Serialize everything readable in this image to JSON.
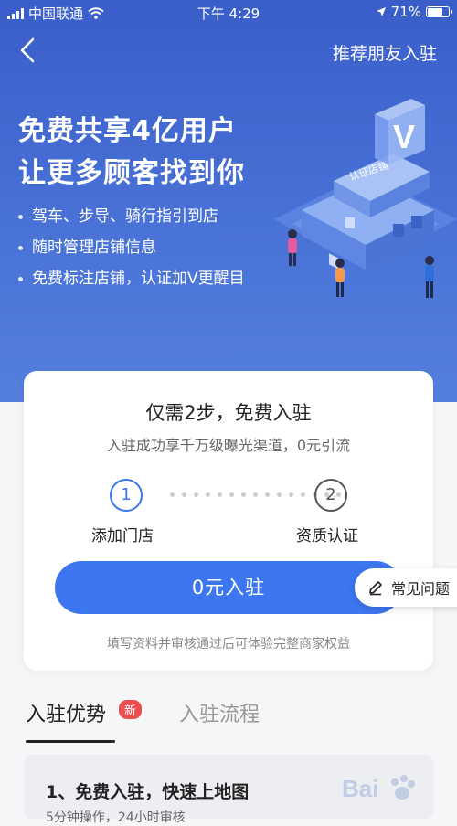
{
  "status_bar": {
    "carrier": "中国联通",
    "time": "下午 4:29",
    "battery": "71%",
    "battery_level": 0.71
  },
  "nav": {
    "back_icon": "chevron-left-icon",
    "right_link": "推荐朋友入驻"
  },
  "hero": {
    "headline_1": "免费共享4亿用户",
    "headline_2": "让更多顾客找到你",
    "bullets": [
      "驾车、步导、骑行指引到店",
      "随时管理店铺信息",
      "免费标注店铺，认证加V更醒目"
    ],
    "illustration_sign": "认证店铺",
    "illustration_letter": "V"
  },
  "card": {
    "title": "仅需2步，免费入驻",
    "subtitle": "入驻成功享千万级曝光渠道，0元引流",
    "steps": [
      {
        "number": "1",
        "label": "添加门店"
      },
      {
        "number": "2",
        "label": "资质认证"
      }
    ],
    "join_button": "0元入驻",
    "note": "填写资料并审核通过后可体验完整商家权益"
  },
  "faq_button": "常见问题",
  "tabs": [
    {
      "label": "入驻优势",
      "badge": "新",
      "active": true
    },
    {
      "label": "入驻流程",
      "active": false
    }
  ],
  "panel": {
    "title": "1、免费入驻，快速上地图",
    "subtitle": "5分钟操作，24小时审核"
  },
  "colors": {
    "hero_top": "#3a5ec9",
    "primary": "#3c76f0",
    "badge": "#ee4d4d"
  }
}
